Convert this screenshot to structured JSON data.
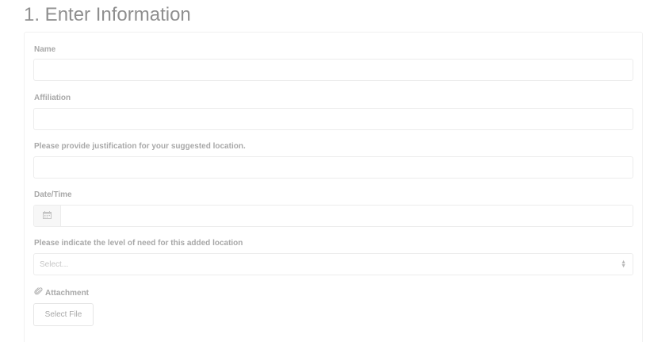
{
  "section": {
    "title": "1. Enter Information"
  },
  "fields": {
    "name": {
      "label": "Name",
      "value": ""
    },
    "affiliation": {
      "label": "Affiliation",
      "value": ""
    },
    "justification": {
      "label": "Please provide justification for your suggested location.",
      "value": ""
    },
    "datetime": {
      "label": "Date/Time",
      "value": "",
      "icon": "calendar-icon"
    },
    "need_level": {
      "label": "Please indicate the level of need for this added location",
      "placeholder": "Select...",
      "icon": "select-arrows-icon"
    },
    "attachment": {
      "label": "Attachment",
      "icon": "paperclip-icon",
      "button_label": "Select File"
    }
  },
  "colors": {
    "title": "#8f8f8f",
    "label": "#a8a8a8",
    "border": "#ececec",
    "placeholder": "#c6c6c6"
  }
}
